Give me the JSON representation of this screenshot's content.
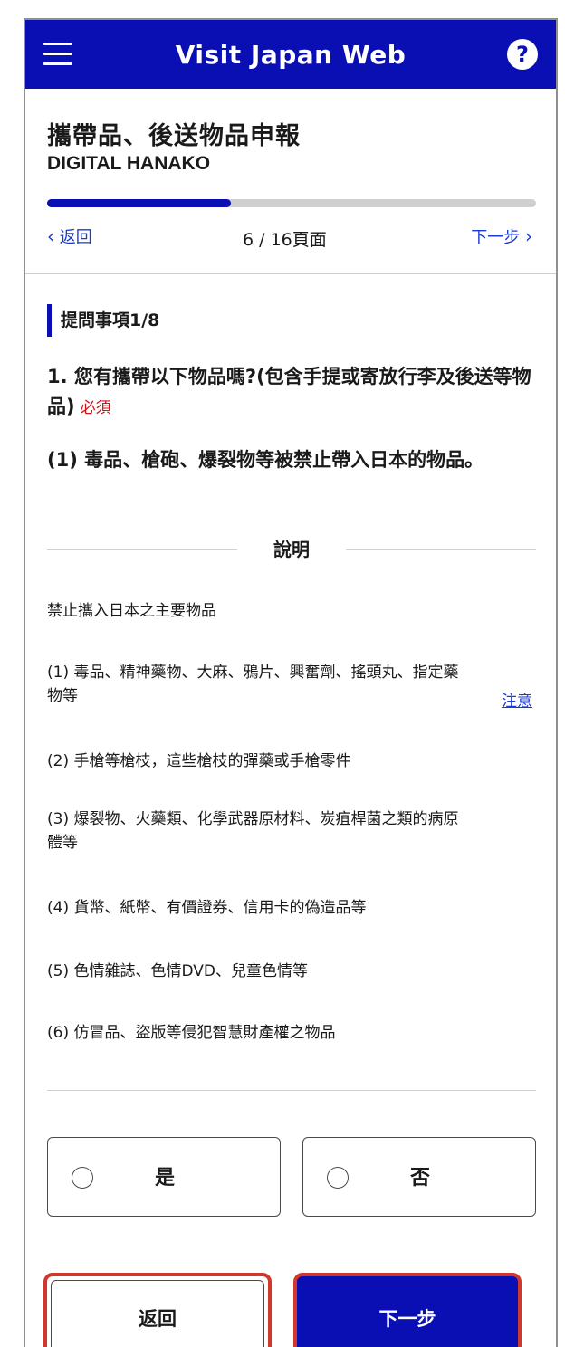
{
  "header": {
    "title": "Visit Japan Web",
    "help_glyph": "?"
  },
  "page": {
    "heading": "攜帶品、後送物品申報",
    "user_name": "DIGITAL HANAKO"
  },
  "progress": {
    "current": 6,
    "total": 16,
    "fraction": 0.375,
    "back_label": "返回",
    "page_text": "6 / 16頁面",
    "next_label": "下一步"
  },
  "question": {
    "counter": "提問事項1/8",
    "text": "1. 您有攜帶以下物品嗎?(包含手提或寄放行李及後送等物品)",
    "required": "必須",
    "sub_text": "(1) 毒品、槍砲、爆裂物等被禁止帶入日本的物品。"
  },
  "explanation": {
    "label": "說明",
    "title": "禁止攜入日本之主要物品",
    "note_link": "注意",
    "items": [
      "(1) 毒品、精神藥物、大麻、鴉片、興奮劑、搖頭丸、指定藥物等",
      "(2) 手槍等槍枝，這些槍枝的彈藥或手槍零件",
      "(3) 爆裂物、火藥類、化學武器原材料、炭疽桿菌之類的病原體等",
      "(4) 貨幣、紙幣、有價證券、信用卡的偽造品等",
      "(5) 色情雜誌、色情DVD、兒童色情等",
      "(6) 仿冒品、盜版等侵犯智慧財產權之物品"
    ]
  },
  "options": {
    "yes": "是",
    "no": "否",
    "selected": null
  },
  "footer": {
    "back_button": "返回",
    "next_button": "下一步"
  },
  "colors": {
    "brand": "#0a0fb4",
    "required": "#d0121b",
    "highlight_border": "#d1382d",
    "link": "#1a3ad0"
  }
}
